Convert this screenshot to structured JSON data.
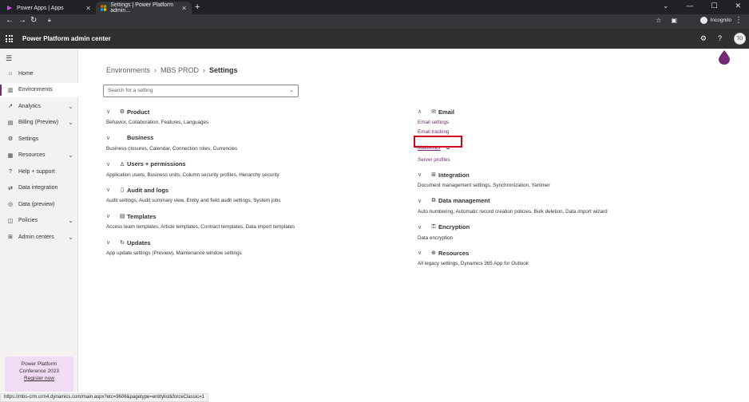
{
  "browser": {
    "tabs": [
      {
        "label": "Power Apps | Apps"
      },
      {
        "label": "Settings | Power Platform admin..."
      }
    ],
    "profile_label": "Incognito",
    "status_url": "https://mbs-crm.crm4.dynamics.com/main.aspx?etc=9606&pagetype=entitylist&forceClassic=1"
  },
  "app": {
    "title": "Power Platform admin center",
    "user_initials": "TG"
  },
  "sidebar": {
    "items": [
      {
        "label": "Home",
        "icon": "home-icon",
        "chevron": false,
        "active": false
      },
      {
        "label": "Environments",
        "icon": "environments-icon",
        "chevron": false,
        "active": true
      },
      {
        "label": "Analytics",
        "icon": "analytics-icon",
        "chevron": true,
        "active": false
      },
      {
        "label": "Billing (Preview)",
        "icon": "billing-icon",
        "chevron": true,
        "active": false
      },
      {
        "label": "Settings",
        "icon": "gear-icon",
        "chevron": false,
        "active": false
      },
      {
        "label": "Resources",
        "icon": "resources-icon",
        "chevron": true,
        "active": false
      },
      {
        "label": "Help + support",
        "icon": "help-icon",
        "chevron": false,
        "active": false
      },
      {
        "label": "Data integration",
        "icon": "data-integration-icon",
        "chevron": false,
        "active": false
      },
      {
        "label": "Data (preview)",
        "icon": "database-icon",
        "chevron": false,
        "active": false
      },
      {
        "label": "Policies",
        "icon": "policies-icon",
        "chevron": true,
        "active": false
      },
      {
        "label": "Admin centers",
        "icon": "admin-centers-icon",
        "chevron": true,
        "active": false
      }
    ],
    "promo": {
      "line1": "Power Platform",
      "line2": "Conference 2023",
      "link": "Register now"
    }
  },
  "breadcrumb": [
    "Environments",
    "MBS PROD",
    "Settings"
  ],
  "search": {
    "placeholder": "Search for a setting"
  },
  "left_groups": [
    {
      "title": "Product",
      "icon": "gear-icon",
      "desc": "Behavior, Collaboration, Features, Languages"
    },
    {
      "title": "Business",
      "icon": "",
      "desc": "Business closures, Calendar, Connection roles, Currencies"
    },
    {
      "title": "Users + permissions",
      "icon": "users-icon",
      "desc": "Application users, Business units, Column security profiles, Hierarchy security"
    },
    {
      "title": "Audit and logs",
      "icon": "audit-icon",
      "desc": "Audit settings, Audit summary view, Entity and field audit settings, System jobs"
    },
    {
      "title": "Templates",
      "icon": "templates-icon",
      "desc": "Access team templates, Article templates, Contract templates, Data import templates"
    },
    {
      "title": "Updates",
      "icon": "refresh-icon",
      "desc": "App update settings (Preview), Maintenance window settings"
    }
  ],
  "email_group": {
    "title": "Email",
    "links": [
      "Email settings",
      "Email tracking"
    ],
    "highlight_link": "Mailboxes",
    "after_link": "Server profiles"
  },
  "right_groups": [
    {
      "title": "Integration",
      "icon": "windows-icon",
      "desc": "Document management settings, Synchronization, Yammer"
    },
    {
      "title": "Data management",
      "icon": "data-management-icon",
      "desc": "Auto numbering, Automatic record creation policies, Bulk deletion, Data import wizard"
    },
    {
      "title": "Encryption",
      "icon": "lock-icon",
      "desc": "Data encryption"
    },
    {
      "title": "Resources",
      "icon": "globe-icon",
      "desc": "All legacy settings, Dynamics 365 App for Outlook"
    }
  ],
  "colors": {
    "accent": "#742774",
    "highlight": "#d0021b",
    "header": "#2f2f2f"
  }
}
